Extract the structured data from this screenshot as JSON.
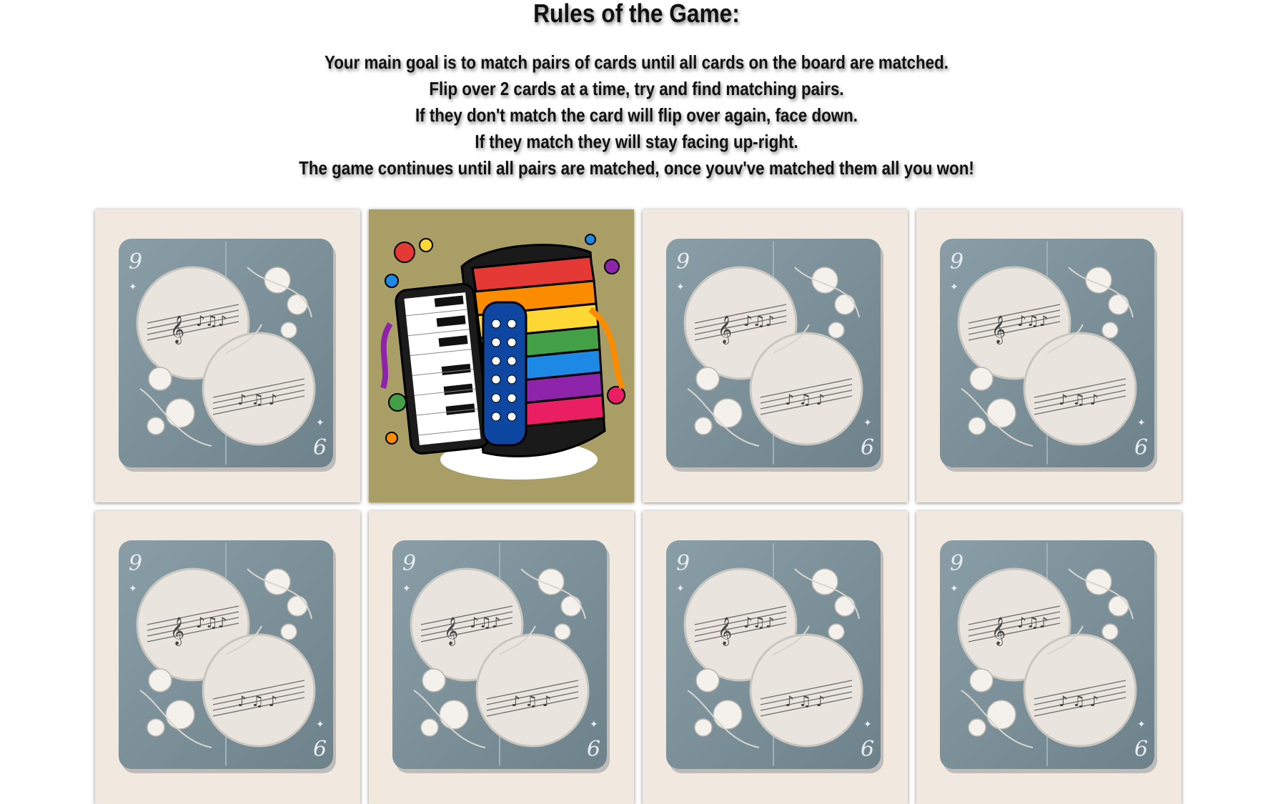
{
  "rules": {
    "title": "Rules of the Game:",
    "lines": [
      "Your main goal is to match pairs of cards until all cards on the board are matched.",
      "Flip over 2 cards at a time, try and find matching pairs.",
      "If they don't match the card will flip over again, face down.",
      "If they match they will stay facing up-right.",
      "The game continues until all pairs are matched, once youv've matched them all you won!"
    ]
  },
  "board": {
    "cards": [
      {
        "state": "face-down",
        "icon": "music-card-back-icon"
      },
      {
        "state": "face-up",
        "icon": "accordion-icon"
      },
      {
        "state": "face-down",
        "icon": "music-card-back-icon"
      },
      {
        "state": "face-down",
        "icon": "music-card-back-icon"
      },
      {
        "state": "face-down",
        "icon": "music-card-back-icon"
      },
      {
        "state": "face-down",
        "icon": "music-card-back-icon"
      },
      {
        "state": "face-down",
        "icon": "music-card-back-icon"
      },
      {
        "state": "face-down",
        "icon": "music-card-back-icon"
      }
    ]
  },
  "colors": {
    "card_back_bg": "#f1e9e0",
    "card_back_panel": "#7e929b",
    "card_face_bg": "#a99e66"
  }
}
